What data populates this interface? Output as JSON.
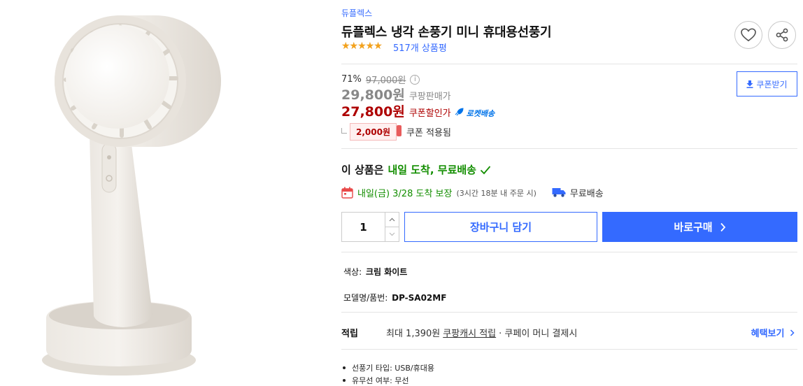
{
  "product": {
    "brand": "듀플렉스",
    "title": "듀플렉스 냉각 손풍기 미니 휴대용선풍기",
    "rating": 4.5,
    "review_count": "517개 상품평"
  },
  "price": {
    "discount_rate": "71%",
    "original_price": "97,000원",
    "info_symbol": "i",
    "sale_price": "29,800원",
    "sale_label": "쿠팡판매가",
    "coupon_price": "27,800원",
    "coupon_label": "쿠폰할인가",
    "rocket_label": "로켓배송",
    "coupon_amount": "2,000원",
    "coupon_applied": "쿠폰 적용됨",
    "coupon_download": "쿠폰받기"
  },
  "delivery": {
    "headline_prefix": "이 상품은",
    "headline_green": "내일 도착, 무료배송",
    "arrival_text": "내일(금) 3/28 도착 보장",
    "arrival_note": "(3시간 18분 내 주문 시)",
    "free_shipping": "무료배송"
  },
  "purchase": {
    "quantity": "1",
    "add_to_cart": "장바구니 담기",
    "buy_now": "바로구매"
  },
  "options": {
    "color_label": "색상:",
    "color_value": "크림 화이트",
    "model_label": "모델명/품번:",
    "model_value": "DP-SA02MF"
  },
  "points": {
    "label": "적립",
    "text": "최대 1,390원",
    "link": "쿠팡캐시 적립",
    "rest": "· 쿠페이 머니 결제시",
    "benefit_link": "혜택보기"
  },
  "specs": [
    "선풍기 타입: USB/휴대용",
    "유무선 여부: 무선"
  ],
  "colors": {
    "accent": "#346aff",
    "price_red": "#ae0000",
    "delivery_green": "#138e00",
    "star": "#f4a21c"
  },
  "icons": {
    "heart": "heart-icon",
    "share": "share-icon",
    "calendar": "calendar-icon",
    "truck": "truck-icon",
    "check": "check-icon",
    "download": "download-icon",
    "rocket": "rocket-icon"
  }
}
